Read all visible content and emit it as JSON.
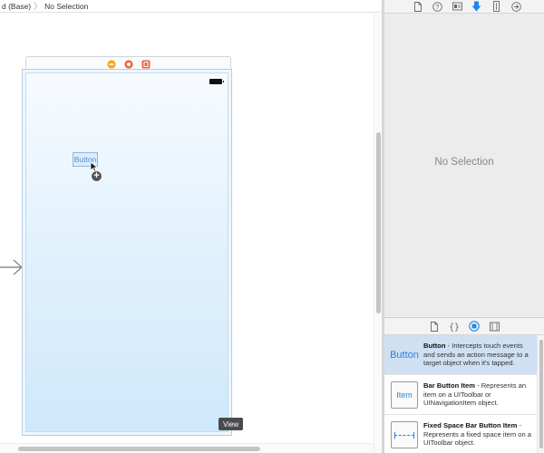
{
  "breadcrumb": {
    "item_1": "d (Base)",
    "separator": "〉",
    "item_2": "No Selection"
  },
  "canvas": {
    "placed_button_label": "Button",
    "view_tag": "View"
  },
  "inspector": {
    "tabs": [
      "file-inspector-icon",
      "quick-help-icon",
      "identity-inspector-icon",
      "attributes-inspector-icon",
      "size-inspector-icon",
      "connections-inspector-icon"
    ],
    "active_tab": "attributes-inspector-icon",
    "empty_message": "No Selection"
  },
  "library": {
    "tabs": [
      "file-template-icon",
      "code-snippet-icon",
      "object-library-icon",
      "media-library-icon"
    ],
    "active_tab": "object-library-icon",
    "items": [
      {
        "thumb_label": "Button",
        "title": "Button",
        "description": " - Intercepts touch events and sends an action message to a target object when it's tapped.",
        "selected": true
      },
      {
        "thumb_label": "Item",
        "title": "Bar Button Item",
        "description": " - Represents an item on a UIToolbar or UINavigationItem object.",
        "selected": false
      },
      {
        "thumb_label": "",
        "title": "Fixed Space Bar Button Item",
        "description": " - Represents a fixed space item on a UIToolbar object.",
        "selected": false
      }
    ]
  },
  "colors": {
    "accent": "#2f7fd8",
    "selection": "#cfe0f3",
    "scene_top": "#f7fbfe",
    "scene_bottom": "#cfe8fb"
  }
}
